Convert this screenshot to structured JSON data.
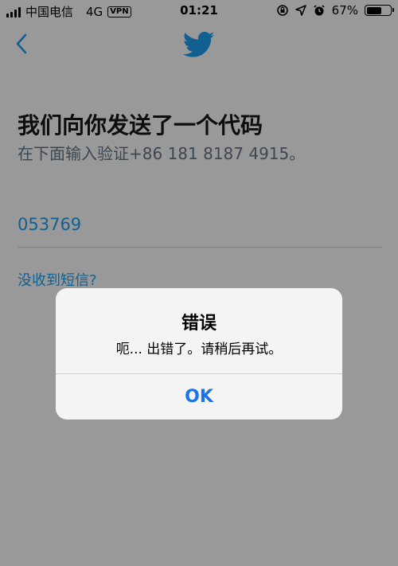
{
  "status_bar": {
    "carrier": "中国电信",
    "network": "4G",
    "vpn": "VPN",
    "time": "01:21",
    "battery_percent": "67%",
    "battery_level": 0.67,
    "icons": [
      "signal-bars-icon",
      "vpn-icon",
      "rotation-lock-icon",
      "location-arrow-icon",
      "alarm-icon",
      "battery-icon"
    ]
  },
  "nav": {
    "back_icon": "chevron-left-icon",
    "logo_icon": "twitter-bird-icon"
  },
  "main": {
    "headline": "我们向你发送了一个代码",
    "subtext": "在下面输入验证+86 181 8187 4915。",
    "code_value": "053769",
    "resend_link": "没收到短信?"
  },
  "alert": {
    "title": "错误",
    "message": "呃... 出错了。请稍后再试。",
    "ok_label": "OK"
  },
  "colors": {
    "accent": "#1da1f2",
    "alert_button": "#1a73e8",
    "headline": "#14171a",
    "secondary_text": "#657786",
    "overlay": "rgba(0,0,0,0.4)"
  }
}
